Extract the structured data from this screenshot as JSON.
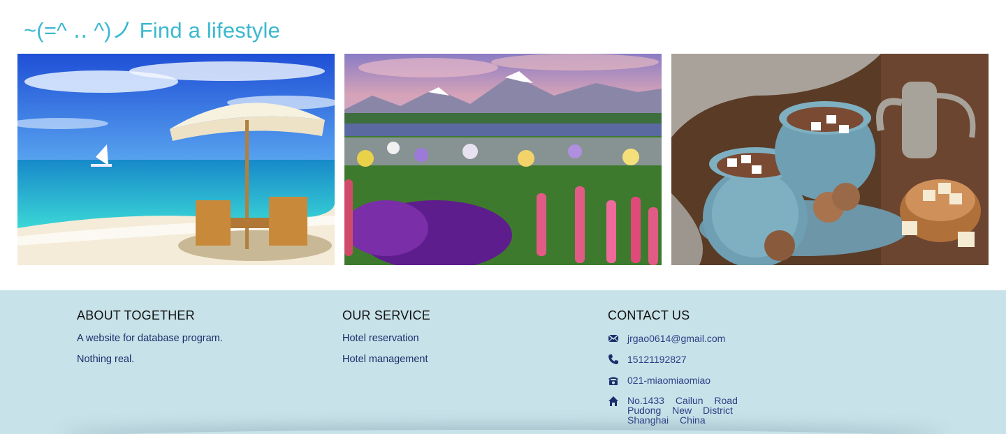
{
  "header": {
    "title": "~(=^ ‥ ^)ノ Find a lifestyle"
  },
  "gallery": {
    "images": [
      {
        "name": "beach-photo",
        "icon": "beach-umbrella-image"
      },
      {
        "name": "mountain-flowers-photo",
        "icon": "mountain-lake-image"
      },
      {
        "name": "hot-cocoa-photo",
        "icon": "cocoa-cups-image"
      }
    ]
  },
  "footer": {
    "about": {
      "heading": "ABOUT TOGETHER",
      "lines": [
        "A website for database program.",
        "Nothing real."
      ]
    },
    "service": {
      "heading": "OUR SERVICE",
      "links": [
        "Hotel reservation",
        "Hotel management"
      ]
    },
    "contact": {
      "heading": "CONTACT US",
      "email": "jrgao0614@gmail.com",
      "mobile": "15121192827",
      "phone": "021-miaomiaomiao",
      "address": [
        "No.1433 Cailun Road",
        "Pudong New District",
        "Shanghai China"
      ]
    }
  },
  "colors": {
    "accent": "#3bb8cf",
    "footer_bg": "#c8e2e9",
    "link": "#1c2d6b"
  }
}
